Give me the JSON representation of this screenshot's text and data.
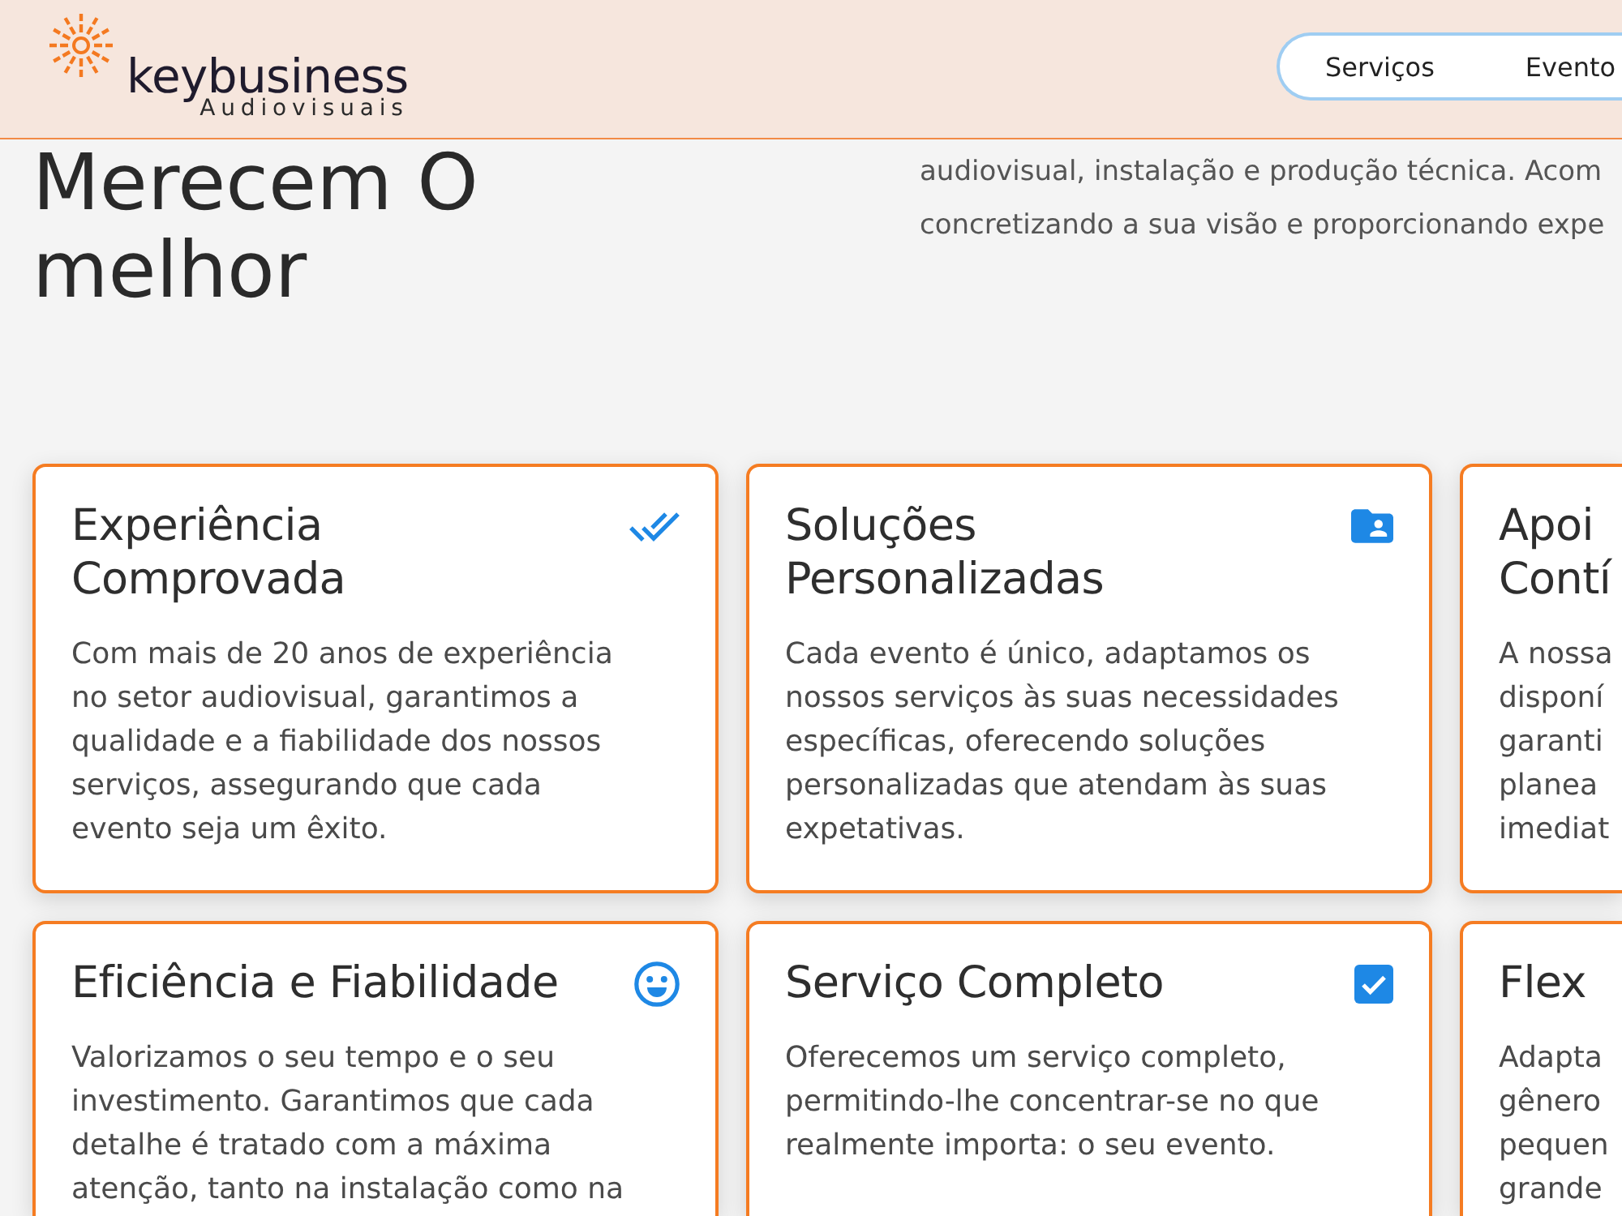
{
  "header": {
    "brand": {
      "name": "keybusiness",
      "tagline": "Audiovisuais"
    },
    "nav": [
      {
        "label": "Serviços"
      },
      {
        "label": "Evento"
      }
    ]
  },
  "hero": {
    "heading_lines": [
      "Merecem O",
      "melhor"
    ],
    "intro_lines": [
      "audiovisual, instalação e produção técnica. Acom",
      "concretizando a sua visão e proporcionando expe"
    ]
  },
  "cards": [
    {
      "title_lines": [
        "Experiência",
        "Comprovada"
      ],
      "text_lines": [
        "Com mais de 20 anos de experiência",
        "no setor audiovisual, garantimos a",
        "qualidade e a fiabilidade dos nossos",
        "serviços, assegurando que cada",
        "evento seja um êxito."
      ]
    },
    {
      "title_lines": [
        "Soluções",
        "Personalizadas"
      ],
      "text_lines": [
        "Cada evento é único, adaptamos os",
        "nossos serviços às suas necessidades",
        "específicas, oferecendo soluções",
        "personalizadas que atendam às suas",
        "expetativas."
      ]
    },
    {
      "title_lines": [
        "Apoi",
        "Contí"
      ],
      "text_lines": [
        "A nossa",
        "disponí",
        "garanti",
        "planea",
        "imediat"
      ]
    },
    {
      "title_lines": [
        "Eficiência e Fiabilidade"
      ],
      "text_lines": [
        "Valorizamos o seu tempo e o seu",
        "investimento. Garantimos que cada",
        "detalhe é tratado com a máxima",
        "atenção, tanto na instalação como na"
      ]
    },
    {
      "title_lines": [
        "Serviço Completo"
      ],
      "text_lines": [
        "Oferecemos um serviço completo,",
        "permitindo-lhe concentrar-se no que",
        "realmente importa: o seu evento."
      ]
    },
    {
      "title_lines": [
        "Flex"
      ],
      "text_lines": [
        "Adapta",
        "gênero",
        "pequen",
        "grande"
      ]
    }
  ]
}
